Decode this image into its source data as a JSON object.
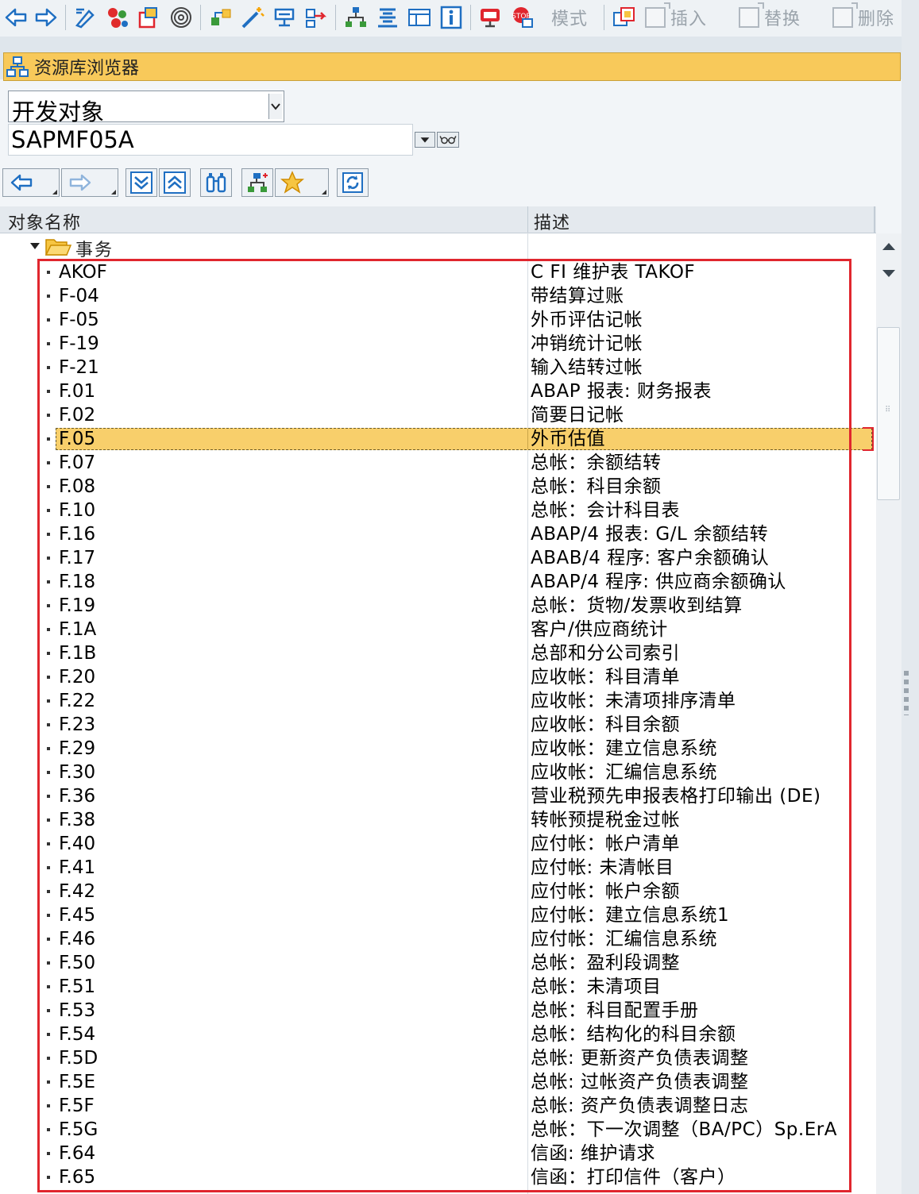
{
  "toolbar": {
    "mode_label": "模式",
    "insert_label": "插入",
    "replace_label": "替换",
    "delete_label": "删除"
  },
  "title": "资源库浏览器",
  "selector": {
    "object_type": "开发对象",
    "object_name": "SAPMF05A"
  },
  "table": {
    "col_name": "对象名称",
    "col_desc": "描述",
    "folder": "事务",
    "rows": [
      {
        "name": "AKOF",
        "desc": "C FI 维护表 TAKOF"
      },
      {
        "name": "F-04",
        "desc": "带结算过账"
      },
      {
        "name": "F-05",
        "desc": "外币评估记帐"
      },
      {
        "name": "F-19",
        "desc": "冲销统计记帐"
      },
      {
        "name": "F-21",
        "desc": "输入结转过帐"
      },
      {
        "name": "F.01",
        "desc": "ABAP 报表: 财务报表"
      },
      {
        "name": "F.02",
        "desc": "简要日记帐"
      },
      {
        "name": "F.05",
        "desc": "外币估值",
        "selected": true
      },
      {
        "name": "F.07",
        "desc": "总帐：余额结转"
      },
      {
        "name": "F.08",
        "desc": "总帐：科目余额"
      },
      {
        "name": "F.10",
        "desc": "总帐：会计科目表"
      },
      {
        "name": "F.16",
        "desc": "ABAP/4 报表: G/L 余额结转"
      },
      {
        "name": "F.17",
        "desc": "ABAB/4 程序: 客户余额确认"
      },
      {
        "name": "F.18",
        "desc": "ABAP/4 程序: 供应商余额确认"
      },
      {
        "name": "F.19",
        "desc": "总帐：货物/发票收到结算"
      },
      {
        "name": "F.1A",
        "desc": "客户/供应商统计"
      },
      {
        "name": "F.1B",
        "desc": "总部和分公司索引"
      },
      {
        "name": "F.20",
        "desc": "应收帐：科目清单"
      },
      {
        "name": "F.22",
        "desc": "应收帐：未清项排序清单"
      },
      {
        "name": "F.23",
        "desc": "应收帐：科目余额"
      },
      {
        "name": "F.29",
        "desc": "应收帐：建立信息系统"
      },
      {
        "name": "F.30",
        "desc": "应收帐：汇编信息系统"
      },
      {
        "name": "F.36",
        "desc": "营业税预先申报表格打印输出 (DE)"
      },
      {
        "name": "F.38",
        "desc": "转帐预提税金过帐"
      },
      {
        "name": "F.40",
        "desc": "应付帐：帐户清单"
      },
      {
        "name": "F.41",
        "desc": "应付帐: 未清帐目"
      },
      {
        "name": "F.42",
        "desc": "应付帐：帐户余额"
      },
      {
        "name": "F.45",
        "desc": "应付帐：建立信息系统1"
      },
      {
        "name": "F.46",
        "desc": "应付帐：汇编信息系统"
      },
      {
        "name": "F.50",
        "desc": "总帐：盈利段调整"
      },
      {
        "name": "F.51",
        "desc": "总帐：未清项目"
      },
      {
        "name": "F.53",
        "desc": "总帐：科目配置手册"
      },
      {
        "name": "F.54",
        "desc": "总帐：结构化的科目余额"
      },
      {
        "name": "F.5D",
        "desc": "总帐: 更新资产负债表调整"
      },
      {
        "name": "F.5E",
        "desc": "总帐: 过帐资产负债表调整"
      },
      {
        "name": "F.5F",
        "desc": "总帐: 资产负债表调整日志"
      },
      {
        "name": "F.5G",
        "desc": "总帐：下一次调整（BA/PC）Sp.ErA"
      },
      {
        "name": "F.64",
        "desc": "信函: 维护请求"
      },
      {
        "name": "F.65",
        "desc": "信函：打印信件（客户）"
      }
    ]
  },
  "colors": {
    "title_bg": "#f8c95a",
    "selected_row": "#f8cf6b",
    "highlight_frame": "#e0262e",
    "icon_blue": "#1f6fc2"
  }
}
